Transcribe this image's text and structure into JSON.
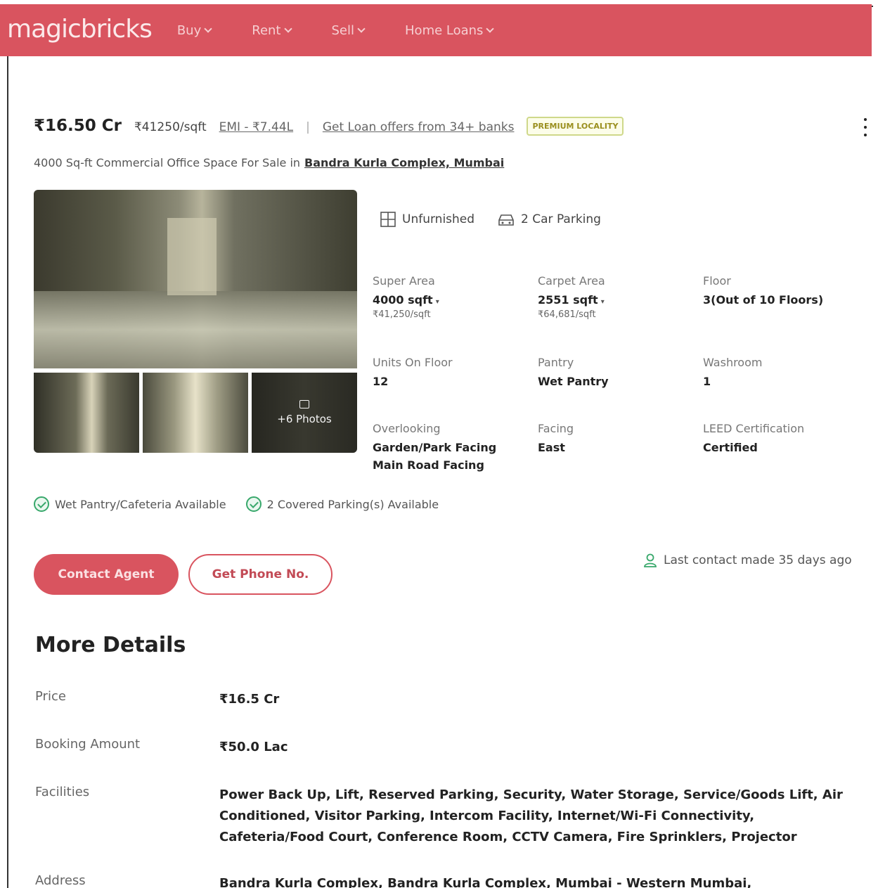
{
  "header": {
    "logo": "magicbricks",
    "nav": [
      "Buy",
      "Rent",
      "Sell",
      "Home Loans"
    ]
  },
  "listing": {
    "price": "₹16.50 Cr",
    "price_per_sqft": "₹41250/sqft",
    "emi": "EMI - ₹7.44L",
    "separator": "|",
    "loan_offers": "Get Loan offers from 34+ banks",
    "badge": "PREMIUM LOCALITY",
    "title_text": "4000 Sq-ft Commercial Office Space For Sale in",
    "location": "Bandra Kurla Complex, Mumbai",
    "photos_more": "+6 Photos"
  },
  "features": {
    "furnishing": "Unfurnished",
    "parking": "2 Car Parking"
  },
  "specs": {
    "super_area": {
      "label": "Super Area",
      "value": "4000 sqft",
      "sub": "₹41,250/sqft"
    },
    "carpet_area": {
      "label": "Carpet Area",
      "value": "2551 sqft",
      "sub": "₹64,681/sqft"
    },
    "floor": {
      "label": "Floor",
      "value": "3(Out of 10 Floors)"
    },
    "units_on_floor": {
      "label": "Units On Floor",
      "value": "12"
    },
    "pantry": {
      "label": "Pantry",
      "value": "Wet Pantry"
    },
    "washroom": {
      "label": "Washroom",
      "value": "1"
    },
    "overlooking": {
      "label": "Overlooking",
      "value": "Garden/Park Facing",
      "value2": "Main Road Facing"
    },
    "facing": {
      "label": "Facing",
      "value": "East"
    },
    "leed": {
      "label": "LEED Certification",
      "value": "Certified"
    }
  },
  "availability": [
    "Wet Pantry/Cafeteria Available",
    "2 Covered Parking(s) Available"
  ],
  "actions": {
    "contact_agent": "Contact Agent",
    "get_phone": "Get Phone No.",
    "last_contact": "Last contact made 35 days ago"
  },
  "more_details": {
    "title": "More Details",
    "rows": [
      {
        "label": "Price",
        "value": "₹16.5 Cr"
      },
      {
        "label": "Booking Amount",
        "value": "₹50.0 Lac"
      },
      {
        "label": "Facilities",
        "value": "Power Back Up, Lift, Reserved Parking, Security, Water Storage, Service/Goods Lift, Air Conditioned, Visitor Parking, Intercom Facility, Internet/Wi-Fi Connectivity, Cafeteria/Food Court, Conference Room, CCTV Camera, Fire Sprinklers, Projector"
      },
      {
        "label": "Address",
        "value": "Bandra Kurla Complex, Bandra Kurla Complex, Mumbai - Western Mumbai,"
      }
    ]
  },
  "colors": {
    "brand": "#d9545f",
    "success": "#38a86b",
    "premium": "#9a8f1e"
  }
}
